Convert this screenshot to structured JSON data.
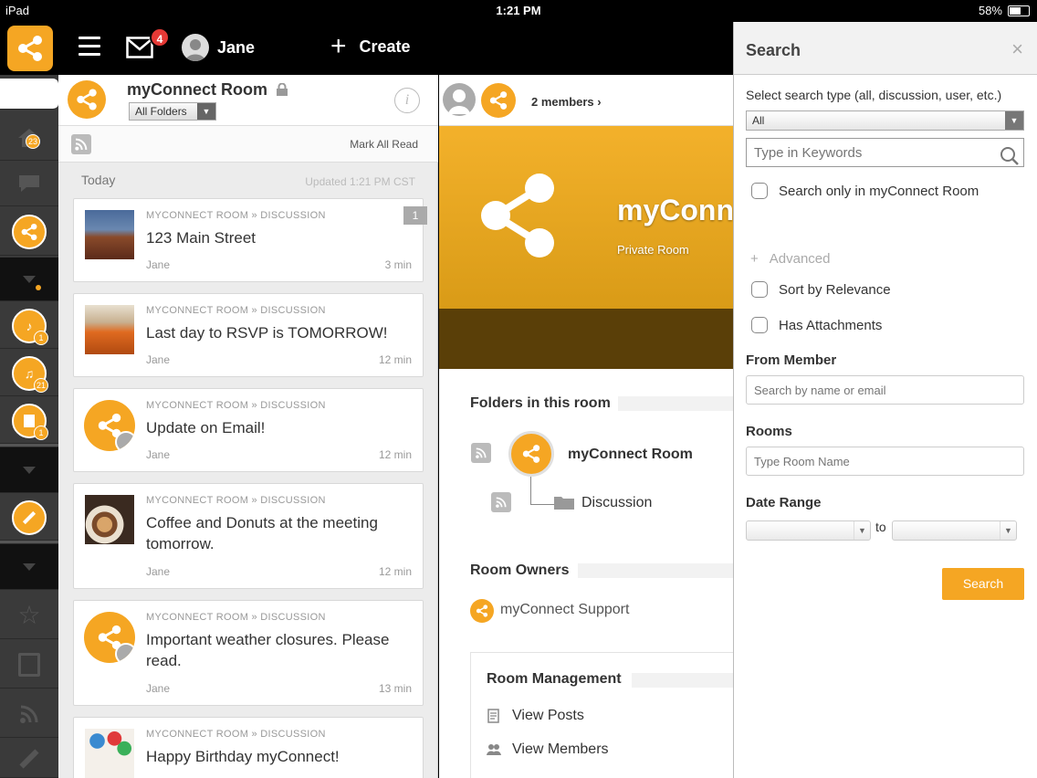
{
  "status_bar": {
    "device": "iPad",
    "time": "1:21 PM",
    "battery": "58%"
  },
  "top_nav": {
    "mail_count": "4",
    "user_name": "Jane",
    "create_label": "Create"
  },
  "rail": {
    "home_badge": "23",
    "badge_1": "1",
    "badge_2": "21",
    "badge_3": "1"
  },
  "room_header": {
    "title": "myConnect Room",
    "folder_select": "All Folders",
    "members_link": "2 members ›"
  },
  "feed": {
    "mark_all_read": "Mark All Read",
    "day": "Today",
    "updated": "Updated 1:21 PM CST",
    "items": [
      {
        "crumb": "MYCONNECT ROOM » DISCUSSION",
        "title": "123 Main Street",
        "author": "Jane",
        "time": "3 min",
        "count": "1"
      },
      {
        "crumb": "MYCONNECT ROOM » DISCUSSION",
        "title": "Last day to RSVP is TOMORROW!",
        "author": "Jane",
        "time": "12 min"
      },
      {
        "crumb": "MYCONNECT ROOM » DISCUSSION",
        "title": "Update on Email!",
        "author": "Jane",
        "time": "12 min"
      },
      {
        "crumb": "MYCONNECT ROOM » DISCUSSION",
        "title": "Coffee and Donuts at the meeting tomorrow.",
        "author": "Jane",
        "time": "12 min"
      },
      {
        "crumb": "MYCONNECT ROOM » DISCUSSION",
        "title": "Important weather closures. Please read.",
        "author": "Jane",
        "time": "13 min"
      },
      {
        "crumb": "MYCONNECT ROOM » DISCUSSION",
        "title": "Happy Birthday myConnect!"
      }
    ]
  },
  "room": {
    "banner_title": "myConnect Room",
    "banner_sub": "Private Room",
    "folders_title": "Folders in this room",
    "tree_room": "myConnect Room",
    "tree_folder": "Discussion",
    "owners_title": "Room Owners",
    "owner_name": "myConnect Support",
    "mgmt_title": "Room Management",
    "mgmt_items": [
      "View Posts",
      "View Members"
    ]
  },
  "search": {
    "title": "Search",
    "close": "×",
    "type_label": "Select search type (all, discussion, user, etc.)",
    "type_value": "All",
    "keywords_placeholder": "Type in Keywords",
    "only_in_room": "Search only in myConnect Room",
    "advanced": "Advanced",
    "sort_relevance": "Sort by Relevance",
    "has_attachments": "Has Attachments",
    "from_member_label": "From Member",
    "from_member_placeholder": "Search by name or email",
    "rooms_label": "Rooms",
    "rooms_placeholder": "Type Room Name",
    "date_range_label": "Date Range",
    "date_to": "to",
    "button": "Search"
  },
  "colors": {
    "accent": "#f5a623",
    "badge_red": "#e53935",
    "rail_bg": "#3a3a3a"
  }
}
